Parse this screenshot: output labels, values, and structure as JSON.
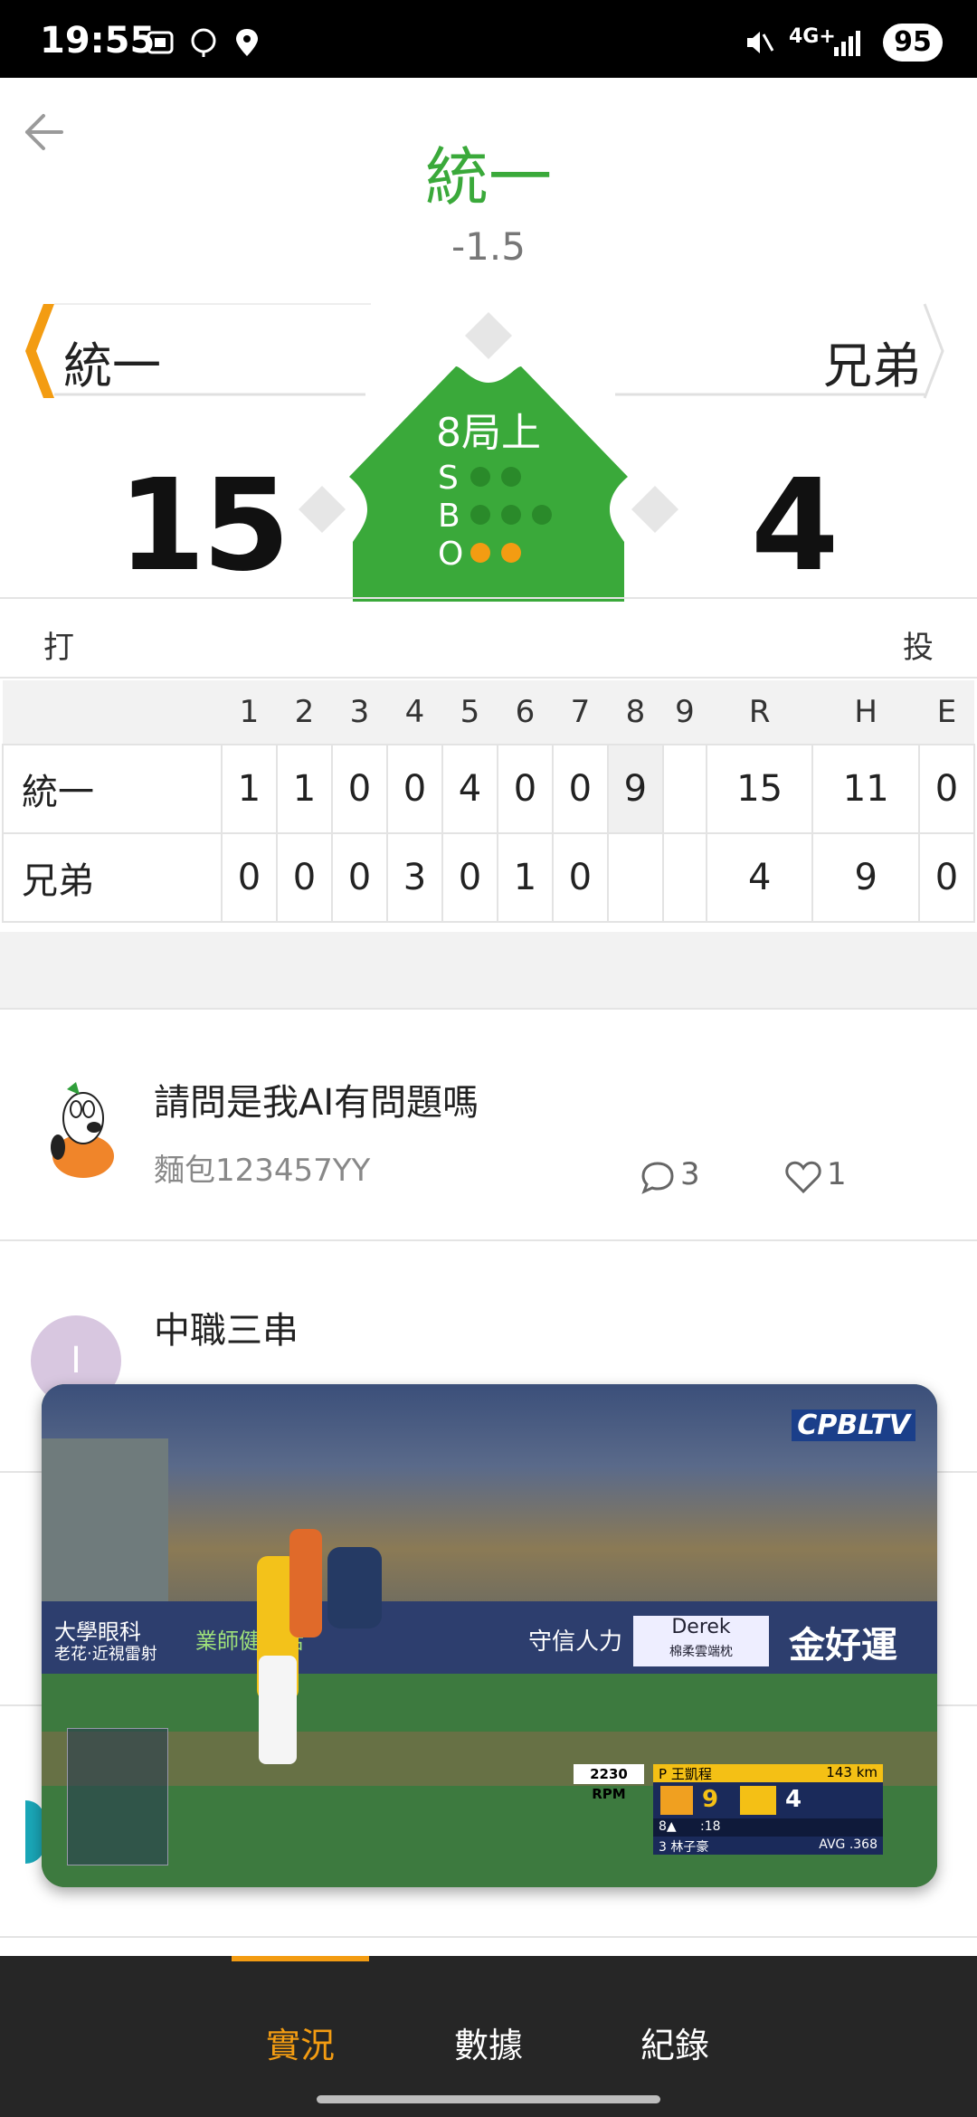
{
  "status": {
    "time": "19:55",
    "battery": "95",
    "network": "4G+"
  },
  "header": {
    "title": "統一",
    "spread": "-1.5"
  },
  "teams": {
    "away": "統一",
    "home": "兄弟"
  },
  "score": {
    "away": "15",
    "home": "4"
  },
  "game": {
    "inning": "8局上",
    "s_label": "S",
    "b_label": "B",
    "o_label": "O",
    "strikes": 0,
    "balls": 0,
    "outs": 2
  },
  "labels": {
    "batting": "打",
    "pitching": "投"
  },
  "scoreboard": {
    "headers": [
      "",
      "1",
      "2",
      "3",
      "4",
      "5",
      "6",
      "7",
      "8",
      "9",
      "R",
      "H",
      "E"
    ],
    "rows": [
      {
        "team": "統一",
        "cells": [
          "1",
          "1",
          "0",
          "0",
          "4",
          "0",
          "0",
          "9",
          "",
          "15",
          "11",
          "0"
        ]
      },
      {
        "team": "兄弟",
        "cells": [
          "0",
          "0",
          "0",
          "3",
          "0",
          "1",
          "0",
          "",
          "",
          "4",
          "9",
          "0"
        ]
      }
    ]
  },
  "posts": [
    {
      "title": "請問是我AI有問題嗎",
      "author": "麵包123457YY",
      "comments": "3",
      "likes": "1"
    },
    {
      "title": "中職三串",
      "avatar_letter": "I"
    }
  ],
  "video": {
    "banner_1": "大學眼科",
    "banner_1_sub": "老花‧近視雷射",
    "banner_2": "業師健生活",
    "banner_3": "守信人力",
    "banner_4": "Derek",
    "banner_4_sub": "棉柔雲端枕",
    "banner_5": "金好運",
    "rpm": "2230 RPM",
    "pitcher": "P 王凱程",
    "speed": "143 km",
    "away_score": "9",
    "home_score": "4",
    "inning_info": "8▲",
    "pitch_count": ":18",
    "batter": "3 林子豪",
    "avg": "AVG .368",
    "brand": "CPBLTV"
  },
  "nav": {
    "tabs": [
      "實況",
      "數據",
      "紀錄"
    ]
  },
  "colors": {
    "accent": "#f39c12",
    "green": "#3aa93a",
    "nav_bg": "#262626"
  }
}
